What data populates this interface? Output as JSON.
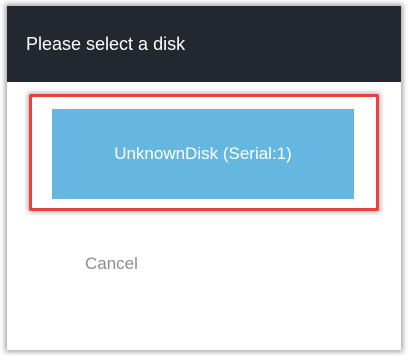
{
  "dialog": {
    "title": "Please select a disk",
    "disk_option_label": "UnknownDisk (Serial:1)",
    "cancel_label": "Cancel",
    "colors": {
      "header_bg": "#232730",
      "disk_button_bg": "#66b7e0",
      "highlight_border": "#e8423a",
      "cancel_text": "#8a8d92"
    }
  }
}
